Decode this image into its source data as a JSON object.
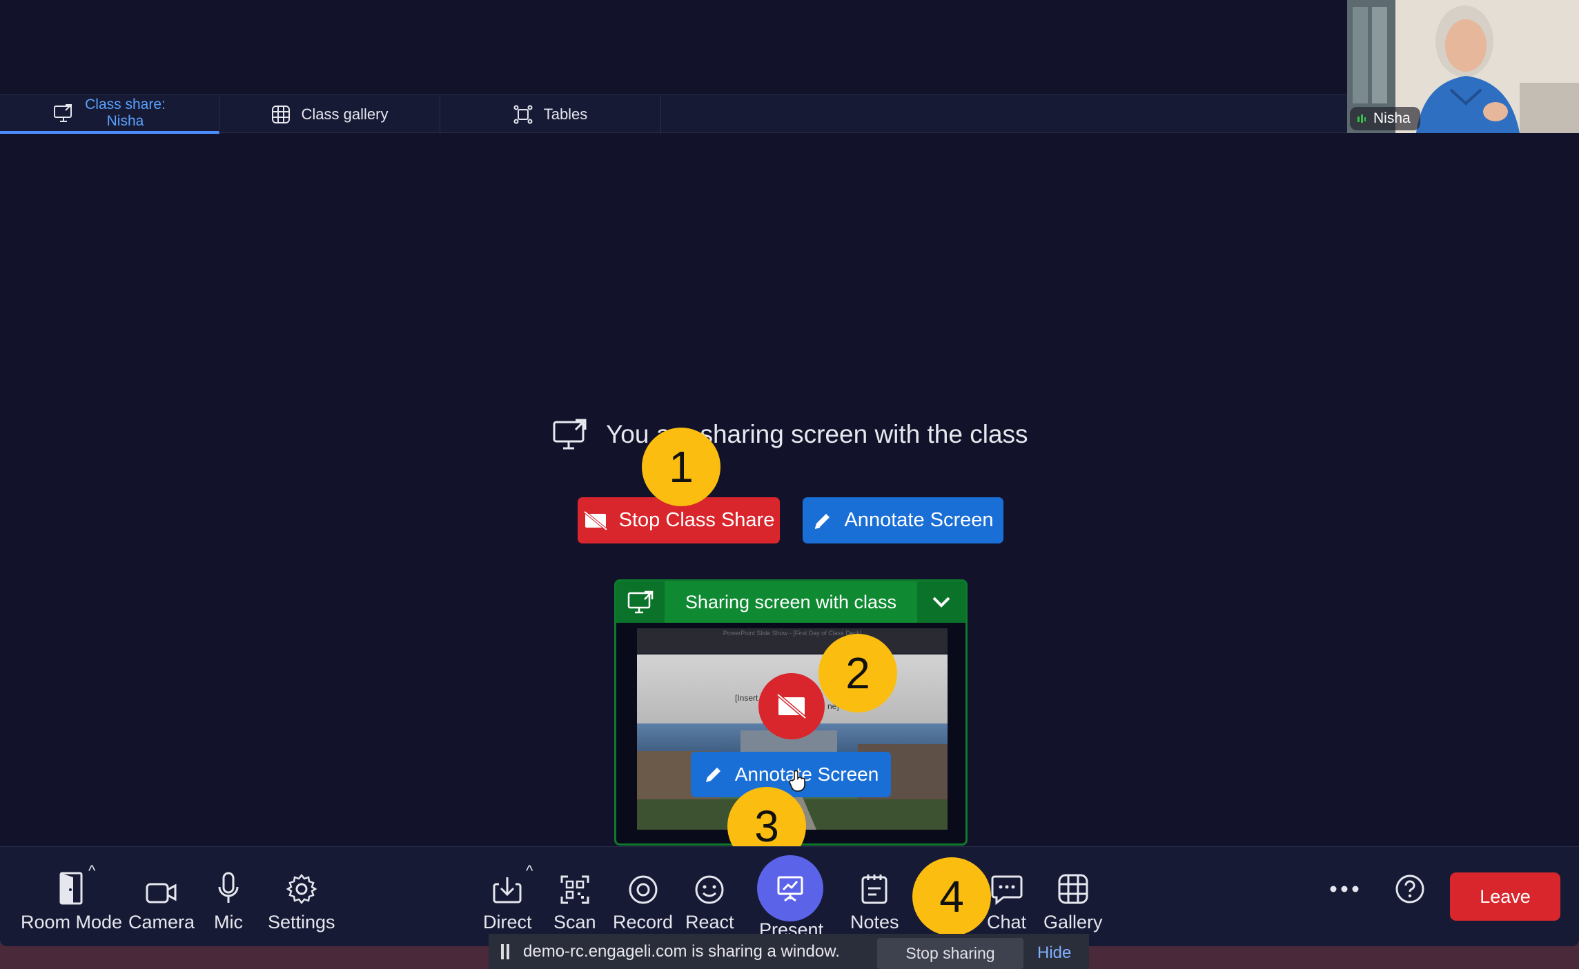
{
  "tabs": [
    {
      "label_line1": "Class share:",
      "label_line2": "Nisha",
      "icon": "monitor-share-icon",
      "active": true
    },
    {
      "label": "Class gallery",
      "icon": "grid-globe-icon"
    },
    {
      "label": "Tables",
      "icon": "tables-icon"
    }
  ],
  "self_video": {
    "name": "Nisha"
  },
  "share_status": {
    "message": "You are sharing screen with the class"
  },
  "actions": {
    "stop_share": "Stop Class Share",
    "annotate": "Annotate Screen"
  },
  "preview": {
    "title": "Sharing screen with class",
    "slide_caption": "PowerPoint Slide Show - [First Day of Class Deck]",
    "slide_text_1": "[Insert",
    "slide_text_2": "ne]",
    "annotate": "Annotate Screen"
  },
  "callouts": [
    "1",
    "2",
    "3",
    "4"
  ],
  "toolbar": {
    "left": [
      "Room Mode",
      "Camera",
      "Mic",
      "Settings"
    ],
    "center": [
      "Direct",
      "Scan",
      "Record",
      "React",
      "Present",
      "Notes",
      "Chat",
      "Gallery"
    ],
    "leave": "Leave"
  },
  "chrome_bar": {
    "message": "demo-rc.engageli.com is sharing a window.",
    "stop": "Stop sharing",
    "hide": "Hide"
  },
  "colors": {
    "background": "#12132b",
    "accent": "#4c8dff",
    "danger": "#d9262c",
    "primary": "#1a6fd6",
    "success": "#0f8a32",
    "callout": "#fbbd0f",
    "present": "#5b63e8"
  }
}
